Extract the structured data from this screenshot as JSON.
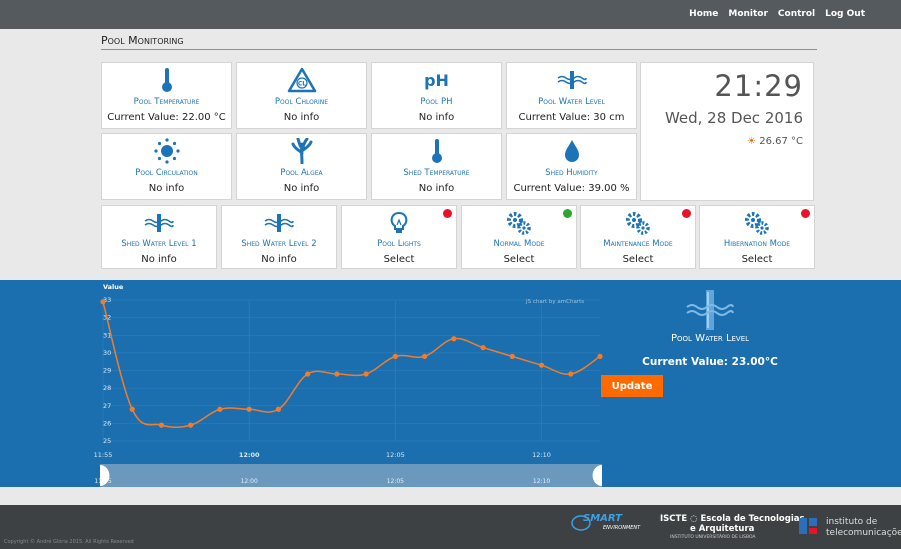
{
  "nav": {
    "home": "Home",
    "monitor": "Monitor",
    "control": "Control",
    "logout": "Log Out"
  },
  "page_title": "Pool Monitoring",
  "tiles_row1": [
    {
      "name": "Pool Temperature",
      "value": "Current Value: 22.00 °C",
      "icon": "thermometer-icon"
    },
    {
      "name": "Pool Chlorine",
      "value": "No info",
      "icon": "chlorine-icon"
    },
    {
      "name": "Pool PH",
      "value": "No info",
      "icon": "ph-icon",
      "icon_text": "pH"
    },
    {
      "name": "Pool Water Level",
      "value": "Current Value: 30 cm",
      "icon": "water-level-icon"
    }
  ],
  "tiles_row2": [
    {
      "name": "Pool Circulation",
      "value": "No info",
      "icon": "circulation-icon"
    },
    {
      "name": "Pool Algea",
      "value": "No info",
      "icon": "algae-icon"
    },
    {
      "name": "Shed Temperature",
      "value": "No info",
      "icon": "thermometer-icon"
    },
    {
      "name": "Shed Humidity",
      "value": "Current Value: 39.00 %",
      "icon": "droplet-icon"
    }
  ],
  "tiles_row3": [
    {
      "name": "Shed Water Level 1",
      "value": "No info",
      "icon": "water-level-icon"
    },
    {
      "name": "Shed Water Level 2",
      "value": "No info",
      "icon": "water-level-icon"
    },
    {
      "name": "Pool Lights",
      "value": "Select",
      "icon": "lightbulb-icon",
      "status": "red"
    },
    {
      "name": "Normal Mode",
      "value": "Select",
      "icon": "gears-icon",
      "status": "green"
    },
    {
      "name": "Maintenance Mode",
      "value": "Select",
      "icon": "gears-icon",
      "status": "red"
    },
    {
      "name": "Hibernation Mode",
      "value": "Select",
      "icon": "gears-icon",
      "status": "red"
    }
  ],
  "clock": {
    "time": "21:29",
    "date": "Wed, 28 Dec 2016",
    "temperature": "26.67 °C",
    "icon": "sun-icon"
  },
  "detail": {
    "name": "Pool Water Level",
    "value": "Current Value: 23.00°C",
    "update_label": "Update"
  },
  "colors": {
    "accent_blue": "#1c73b7",
    "panel_blue": "#1b6fae",
    "orange": "#ff6a00",
    "status_red": "#e8132b",
    "status_green": "#2ea52e"
  },
  "chart_data": {
    "type": "line",
    "ylabel": "Value",
    "credit": "JS chart by amCharts",
    "y_ticks": [
      25,
      26,
      27,
      28,
      29,
      30,
      31,
      32,
      33
    ],
    "ylim": [
      25,
      33
    ],
    "x_ticks": [
      "11:55",
      "12:00",
      "12:05",
      "12:10"
    ],
    "x_ticks_bold": [
      "12:00"
    ],
    "scrollbar_ticks": [
      "11:55",
      "12:00",
      "12:05",
      "12:10"
    ],
    "x": [
      0,
      1,
      2,
      3,
      4,
      5,
      6,
      7,
      8,
      9,
      10,
      11,
      12,
      13,
      14,
      15,
      16,
      17
    ],
    "x_tick_positions": [
      0,
      5,
      10,
      15
    ],
    "values": [
      32.9,
      26.8,
      25.9,
      25.9,
      26.8,
      26.8,
      26.8,
      28.8,
      28.8,
      28.8,
      29.8,
      29.8,
      30.8,
      30.3,
      29.8,
      29.3,
      28.8,
      29.8
    ],
    "grid": true,
    "color": "#f07d2e"
  },
  "footer": {
    "copyright": "Copyright © André Glória 2015. All Rights Reserved",
    "smart_logo": "SMART",
    "smart_logo_sub": "ENVIRONMENT",
    "iscte_line1": "ISCTE ◌ Escola de Tecnologias",
    "iscte_line2": "e Arquitetura",
    "iscte_line3": "INSTITUTO UNIVERSITÁRIO DE LISBOA",
    "it_line1": "instituto de",
    "it_line2": "telecomunicações"
  }
}
